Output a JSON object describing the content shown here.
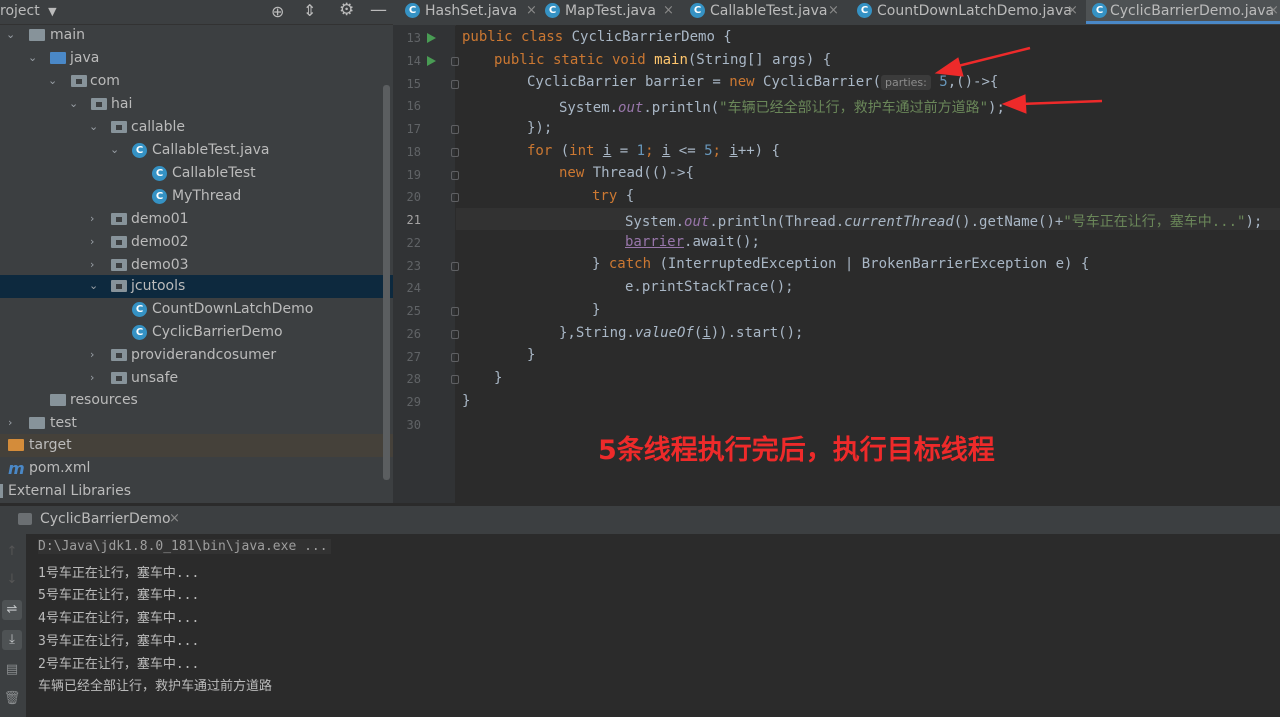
{
  "project_panel": {
    "title": "roject",
    "tree": [
      {
        "label": "main",
        "kind": "folder",
        "expanded": true
      },
      {
        "label": "java",
        "kind": "folder-src",
        "expanded": true
      },
      {
        "label": "com",
        "kind": "package",
        "expanded": true
      },
      {
        "label": "hai",
        "kind": "package",
        "expanded": true
      },
      {
        "label": "callable",
        "kind": "package",
        "expanded": true
      },
      {
        "label": "CallableTest.java",
        "kind": "class-file",
        "expanded": true
      },
      {
        "label": "CallableTest",
        "kind": "class"
      },
      {
        "label": "MyThread",
        "kind": "class"
      },
      {
        "label": "demo01",
        "kind": "package",
        "expanded": false
      },
      {
        "label": "demo02",
        "kind": "package",
        "expanded": false
      },
      {
        "label": "demo03",
        "kind": "package",
        "expanded": false
      },
      {
        "label": "jcutools",
        "kind": "package",
        "expanded": true,
        "selected": true
      },
      {
        "label": "CountDownLatchDemo",
        "kind": "class"
      },
      {
        "label": "CyclicBarrierDemo",
        "kind": "class"
      },
      {
        "label": "providerandcosumer",
        "kind": "package",
        "expanded": false
      },
      {
        "label": "unsafe",
        "kind": "package",
        "expanded": false
      },
      {
        "label": "resources",
        "kind": "resources"
      },
      {
        "label": "test",
        "kind": "folder",
        "expanded": false
      },
      {
        "label": "target",
        "kind": "folder-excluded"
      },
      {
        "label": "pom.xml",
        "kind": "maven"
      },
      {
        "label": "External Libraries",
        "kind": "libraries"
      }
    ]
  },
  "tabs": [
    {
      "label": "HashSet.java",
      "active": false
    },
    {
      "label": "MapTest.java",
      "active": false
    },
    {
      "label": "CallableTest.java",
      "active": false
    },
    {
      "label": "CountDownLatchDemo.java",
      "active": false
    },
    {
      "label": "CyclicBarrierDemo.java",
      "active": true
    }
  ],
  "editor": {
    "current_line": "21",
    "line_numbers": [
      "13",
      "14",
      "15",
      "16",
      "17",
      "18",
      "19",
      "20",
      "21",
      "22",
      "23",
      "24",
      "25",
      "26",
      "27",
      "28",
      "29",
      "30"
    ],
    "param_hint": "parties:",
    "annotation": "5条线程执行完后，执行目标线程",
    "code": {
      "l13_kw": "public class",
      "l13_rest": " CyclicBarrierDemo {",
      "l14_kw": "public static void",
      "l14_mn": "main",
      "l14_rest": "(String[] args) {",
      "l15_a": "CyclicBarrier barrier = ",
      "l15_kw": "new",
      "l15_b": " CyclicBarrier(",
      "l15_num": "5",
      "l15_c": ",()->{",
      "l16_a": "System.",
      "l16_fld": "out",
      "l16_b": ".println(",
      "l16_str": "\"车辆已经全部让行，救护车通过前方道路\"",
      "l16_c": ");",
      "l17": "});",
      "l18_kw": "for",
      "l18_a": " (",
      "l18_kw2": "int",
      "l18_i1": "i",
      "l18_b": " = ",
      "l18_n1": "1",
      "l18_c": "; ",
      "l18_i2": "i",
      "l18_d": " <= ",
      "l18_n2": "5",
      "l18_e": "; ",
      "l18_i3": "i",
      "l18_f": "++) {",
      "l19_kw": "new",
      "l19_rest": " Thread(()->{",
      "l20_kw": "try",
      "l20_rest": " {",
      "l21_a": "System.",
      "l21_fld": "out",
      "l21_b": ".println(Thread.",
      "l21_st": "currentThread",
      "l21_c": "().getName()+",
      "l21_str": "\"号车正在让行，塞车中...\"",
      "l21_d": ");",
      "l22_var": "barrier",
      "l22_rest": ".await();",
      "l23_a": "} ",
      "l23_kw": "catch",
      "l23_rest": " (InterruptedException | BrokenBarrierException e) {",
      "l24": "e.printStackTrace();",
      "l25": "}",
      "l26_a": "},String.",
      "l26_st": "valueOf",
      "l26_b": "(",
      "l26_i": "i",
      "l26_c": ")).start();",
      "l27": "}",
      "l28": "}",
      "l29": "}"
    }
  },
  "run_panel": {
    "tab_label": "CyclicBarrierDemo",
    "output": [
      "D:\\Java\\jdk1.8.0_181\\bin\\java.exe ...",
      "1号车正在让行，塞车中...",
      "5号车正在让行，塞车中...",
      "4号车正在让行，塞车中...",
      "3号车正在让行，塞车中...",
      "2号车正在让行，塞车中...",
      "车辆已经全部让行，救护车通过前方道路"
    ]
  },
  "colors": {
    "annotation_red": "#ee2a2a",
    "keyword": "#cc7832",
    "string": "#6a8759",
    "method": "#ffc66d",
    "number": "#6897bb",
    "field": "#9876aa"
  }
}
